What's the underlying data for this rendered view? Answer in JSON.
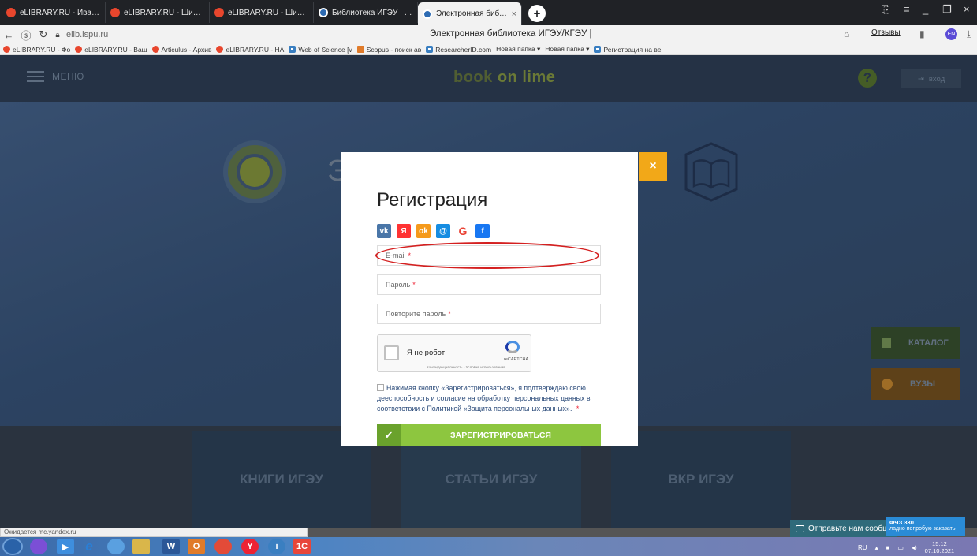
{
  "browser": {
    "tabs": [
      {
        "label": "eLIBRARY.RU - Ивановское",
        "icon": "elibrary-favicon",
        "active": false
      },
      {
        "label": "eLIBRARY.RU - Шипко Ми",
        "icon": "elibrary-favicon",
        "active": false
      },
      {
        "label": "eLIBRARY.RU - Шипко Ми",
        "icon": "elibrary-favicon",
        "active": false
      },
      {
        "label": "Библиотека ИГЭУ | Универ",
        "icon": "library-favicon",
        "active": false
      },
      {
        "label": "Электронная библиоте",
        "icon": "library-favicon",
        "active": true
      }
    ],
    "new_tab": "+",
    "url": "elib.ispu.ru",
    "page_title": "Электронная библиотека ИГЭУ/КГЭУ |",
    "reviews_label": "Отзывы",
    "lang_badge": "EN",
    "bookmarks": [
      {
        "label": "eLIBRARY.RU - Фо",
        "icon": "elibrary-favicon"
      },
      {
        "label": "eLIBRARY.RU - Ваш",
        "icon": "elibrary-favicon"
      },
      {
        "label": "Articulus - Архив",
        "icon": "elibrary-favicon"
      },
      {
        "label": "eLIBRARY.RU - НА",
        "icon": "elibrary-favicon"
      },
      {
        "label": "Web of Science [v",
        "icon": "wos-favicon"
      },
      {
        "label": "Scopus - поиск ав",
        "icon": "scopus-favicon"
      },
      {
        "label": "ResearcherID.com",
        "icon": "wos-favicon"
      },
      {
        "label": "Новая папка ▾",
        "icon": ""
      },
      {
        "label": "Новая папка ▾",
        "icon": ""
      },
      {
        "label": "Регистрация на ве",
        "icon": "wos-favicon"
      }
    ]
  },
  "site": {
    "menu_label": "МЕНЮ",
    "logo_text": "b",
    "logo_mid": "ook",
    "logo_tail": " on lime",
    "help_symbol": "?",
    "login_label": "вход",
    "hero_title_initial": "Э",
    "catalog_label": "КАТАЛОГ",
    "vuz_label": "ВУЗЫ",
    "cards": [
      "КНИГИ ИГЭУ",
      "СТАТЬИ ИГЭУ",
      "ВКР ИГЭУ"
    ]
  },
  "modal": {
    "title": "Регистрация",
    "close_symbol": "×",
    "socials": [
      {
        "name": "vk-icon",
        "glyph": "vk",
        "cls": "s-vk"
      },
      {
        "name": "yandex-icon",
        "glyph": "Я",
        "cls": "s-ya"
      },
      {
        "name": "odnoklassniki-icon",
        "glyph": "ok",
        "cls": "s-ok"
      },
      {
        "name": "mail-ru-icon",
        "glyph": "@",
        "cls": "s-mail"
      },
      {
        "name": "google-icon",
        "glyph": "G",
        "cls": "s-g"
      },
      {
        "name": "facebook-icon",
        "glyph": "f",
        "cls": "s-fb"
      }
    ],
    "email_placeholder": "E-mail",
    "password_placeholder": "Пароль",
    "password_repeat_placeholder": "Повторите пароль",
    "required_mark": "*",
    "captcha_label": "Я не робот",
    "captcha_brand": "reCAPTCHA",
    "captcha_terms": "Конфиденциальность - Условия использования",
    "consent_text": "Нажимая кнопку «Зарегистрироваться», я подтверждаю свою дееспособность и согласие на обработку персональных данных в соответствии с Политикой «Защита персональных данных».",
    "submit_label": "ЗАРЕГИСТРИРОВАТЬСЯ",
    "highlight_color": "#d42020"
  },
  "status": {
    "loading_text": "Ожидается mc.yandex.ru",
    "chat_text": "Отправьте нам сообщ",
    "promo_title": "ФЧЗ 330",
    "promo_text": "ладно попробую заказать"
  },
  "taskbar": {
    "lang": "RU",
    "time": "15:12",
    "date": "07.10.2021"
  }
}
